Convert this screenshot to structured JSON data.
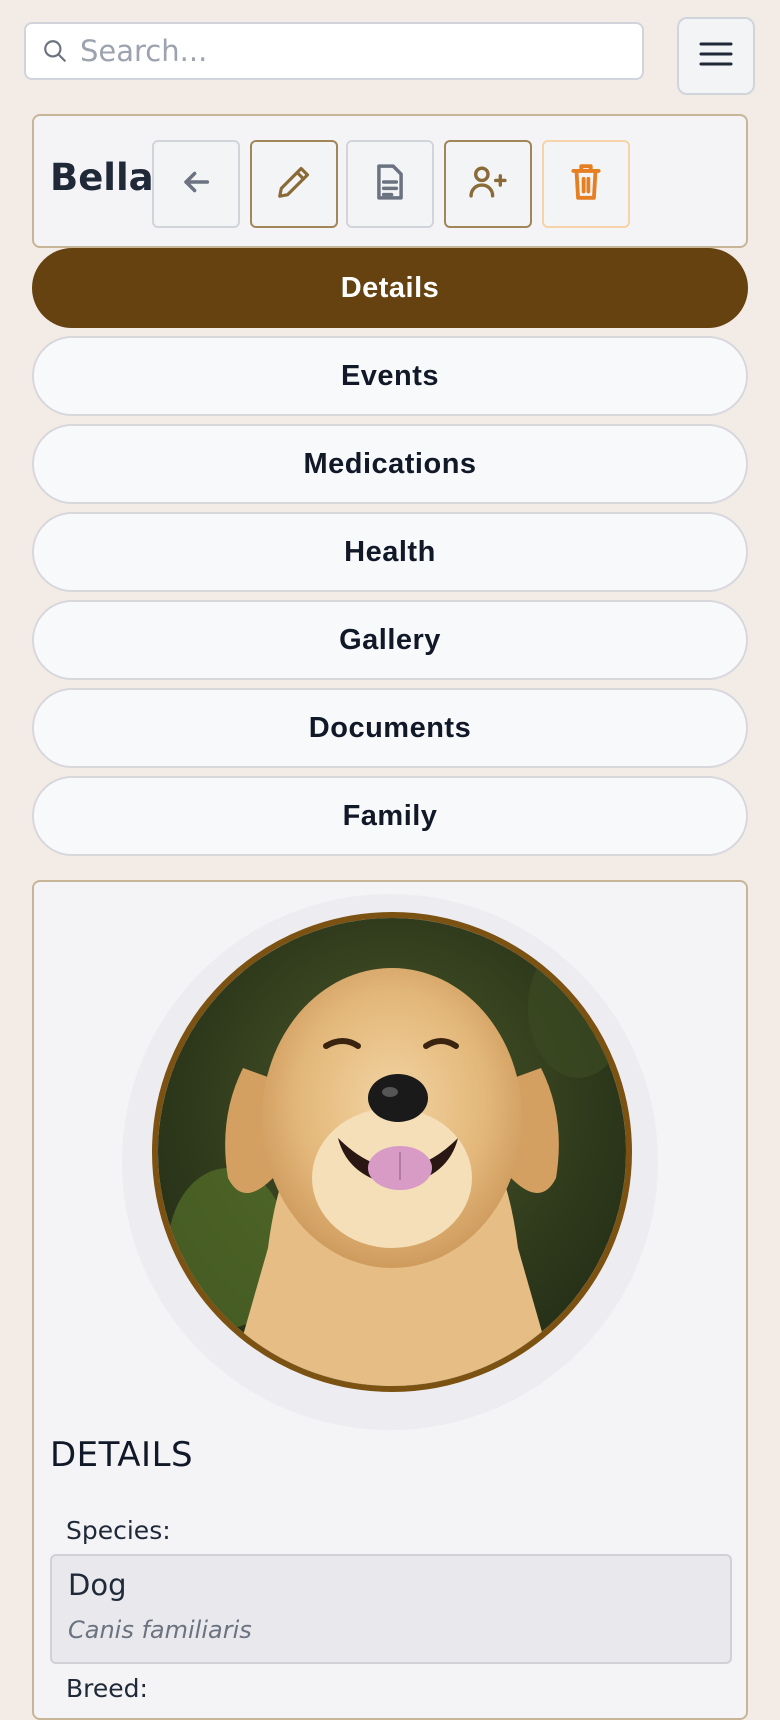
{
  "search": {
    "placeholder": "Search..."
  },
  "header": {
    "pet_name": "Bella",
    "actions": [
      {
        "name": "back-button",
        "icon": "arrow-left-icon"
      },
      {
        "name": "edit-button",
        "icon": "pencil-icon"
      },
      {
        "name": "document-button",
        "icon": "document-icon"
      },
      {
        "name": "add-person-button",
        "icon": "user-plus-icon"
      },
      {
        "name": "delete-button",
        "icon": "trash-icon"
      }
    ]
  },
  "tabs": [
    {
      "label": "Details",
      "active": true
    },
    {
      "label": "Events"
    },
    {
      "label": "Medications"
    },
    {
      "label": "Health"
    },
    {
      "label": "Gallery"
    },
    {
      "label": "Documents"
    },
    {
      "label": "Family"
    }
  ],
  "details": {
    "section_title": "DETAILS",
    "species_label": "Species:",
    "species_value": "Dog",
    "species_scientific": "Canis familiaris",
    "breed_label": "Breed:"
  },
  "colors": {
    "accent": "#65420f",
    "background": "#f3ebe6",
    "card_border": "#c8b597",
    "danger": "#e67e22"
  }
}
